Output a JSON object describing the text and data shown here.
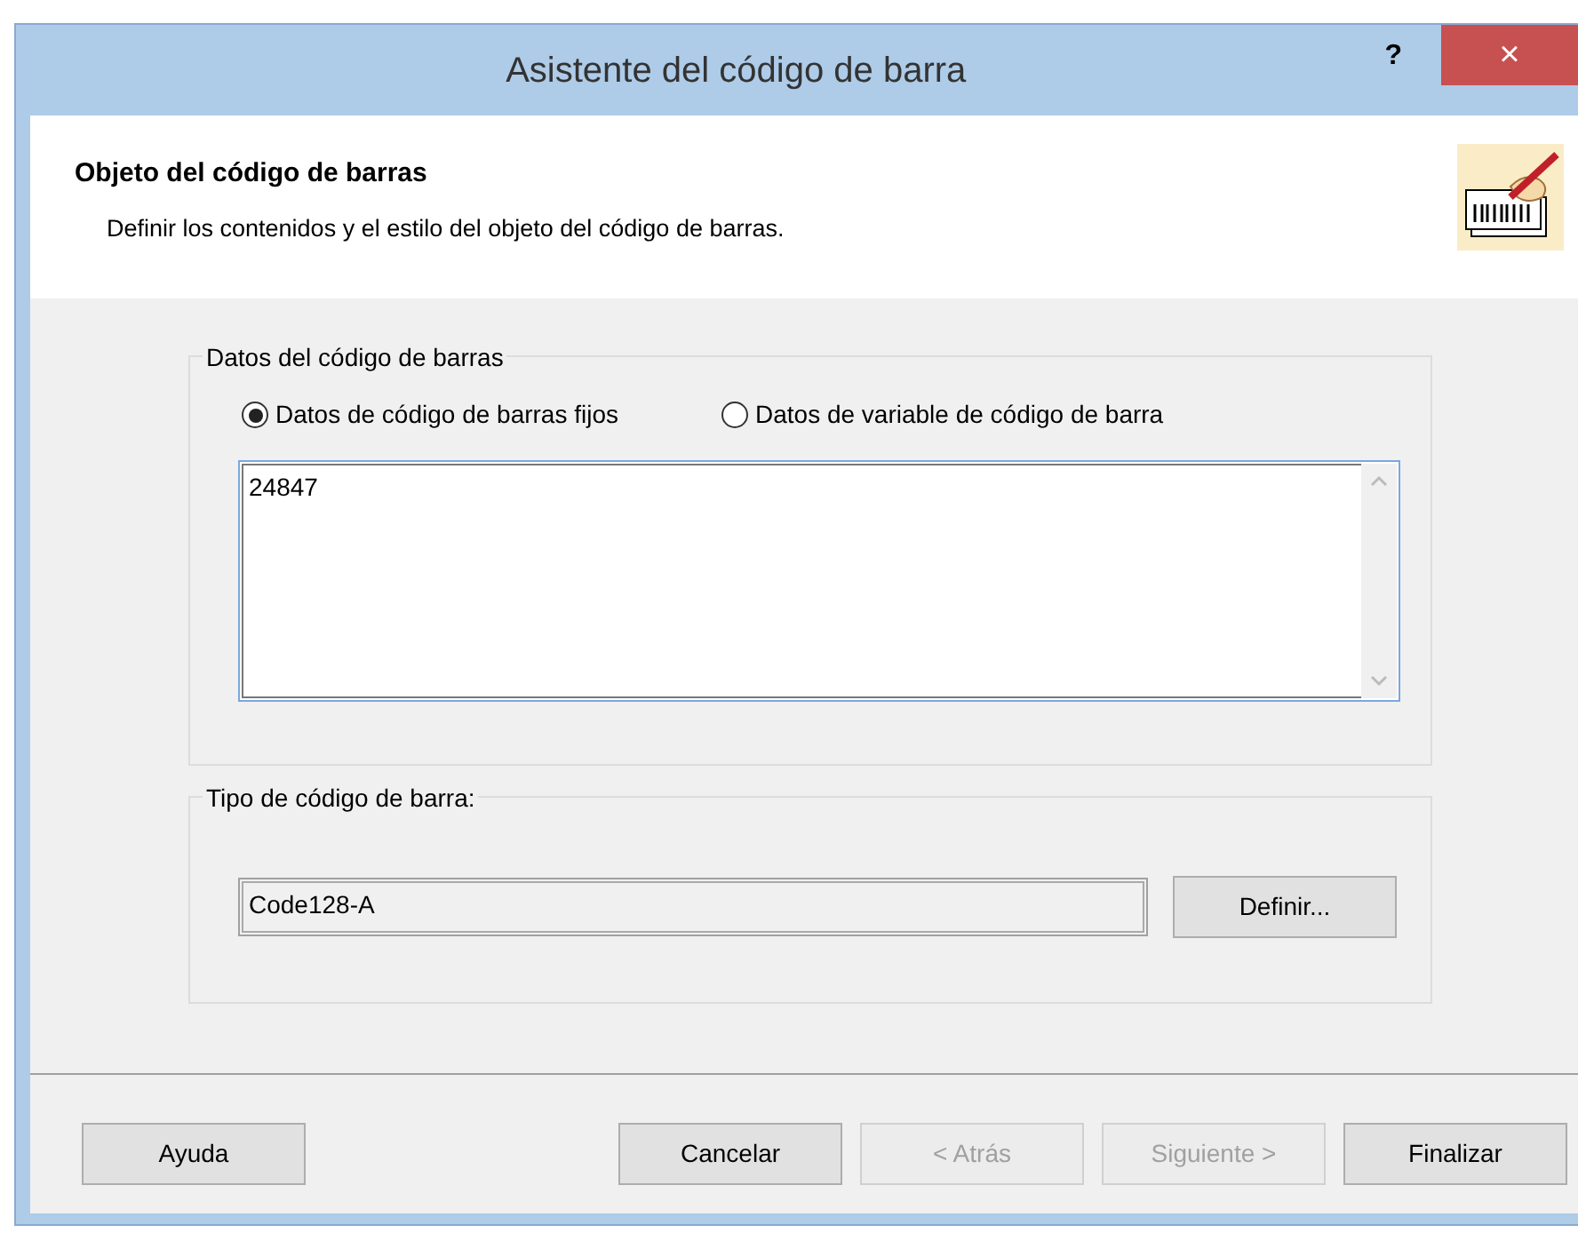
{
  "window": {
    "title": "Asistente del código de barra",
    "help": "?",
    "close": "×"
  },
  "header": {
    "title": "Objeto del código de barras",
    "subtitle": "Definir los contenidos y el estilo del objeto del código de barras."
  },
  "data_group": {
    "legend": "Datos del código de barras",
    "options": [
      {
        "label": "Datos de código de barras fijos",
        "selected": true
      },
      {
        "label": "Datos de variable de código de barra",
        "selected": false
      }
    ],
    "value": "24847"
  },
  "type_group": {
    "legend": "Tipo de código de barra:",
    "value": "Code128-A",
    "button": "Definir..."
  },
  "buttons": [
    {
      "label": "Ayuda",
      "disabled": false
    },
    {
      "label": "Cancelar",
      "disabled": false
    },
    {
      "label": "< Atrás",
      "disabled": true
    },
    {
      "label": "Siguiente >",
      "disabled": true
    },
    {
      "label": "Finalizar",
      "disabled": false
    }
  ]
}
